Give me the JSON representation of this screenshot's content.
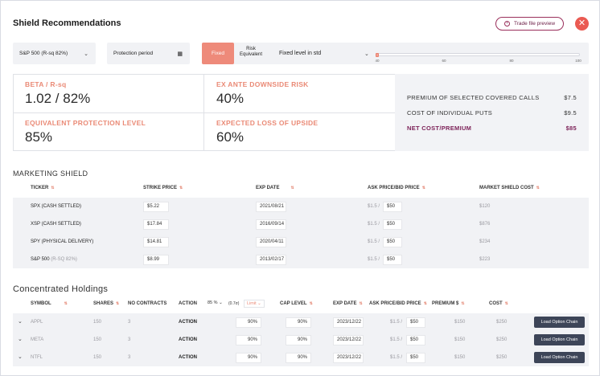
{
  "header": {
    "title": "Shield Recommendations",
    "trade_preview_label": "Trade file preview",
    "close_symbol": "✕"
  },
  "controls": {
    "index_select": "S&P 500 (R-sq 82%)",
    "protection_period_label": "Protection period",
    "fixed_label": "Fixed",
    "risk_equivalent_label": "Risk\nEquivalent",
    "risk_select": "Fixed level in std",
    "slider": {
      "ticks": [
        "40",
        "60",
        "80",
        "100"
      ],
      "value_fraction": 0.0
    }
  },
  "stats": {
    "beta_label": "BETA / R-sq",
    "beta_value": "1.02 / 82%",
    "risk_label": "EX ANTE DOWNSIDE RISK",
    "risk_value": "40%",
    "protect_label": "EQUIVALENT PROTECTION LEVEL",
    "protect_value": "85%",
    "loss_label": "EXPECTED LOSS OF UPSIDE",
    "loss_value": "60%"
  },
  "costs": [
    {
      "label": "PREMIUM OF SELECTED COVERED CALLS",
      "value": "$7.5"
    },
    {
      "label": "COST OF INDIVIDUAL PUTS",
      "value": "$9.5"
    },
    {
      "label": "NET COST/PREMIUM",
      "value": "$85"
    }
  ],
  "marketing": {
    "title": "MARKETING SHIELD",
    "headers": [
      "TICKER",
      "STRIKE PRICE",
      "EXP DATE",
      "ASK PRICE/BID PRICE",
      "MARKET SHIELD COST"
    ],
    "rows": [
      {
        "ticker": "SPX (CASH SETTLED)",
        "strike": "$5.22",
        "exp": "2021/08/21",
        "ask": "$1.5 /",
        "bid": "$50",
        "cost": "$120"
      },
      {
        "ticker": "XSP (CASH SETTLED)",
        "strike": "$17.84",
        "exp": "2016/09/14",
        "ask": "$1.5 /",
        "bid": "$50",
        "cost": "$876"
      },
      {
        "ticker": "SPY (PHYSICAL DELIVERY)",
        "strike": "$14.81",
        "exp": "2020/04/11",
        "ask": "$1.5 /",
        "bid": "$50",
        "cost": "$234"
      },
      {
        "ticker": "S&P 500",
        "ticker_suffix": "(R-SQ 82%)",
        "strike": "$8.99",
        "exp": "2013/02/17",
        "ask": "$1.5 /",
        "bid": "$50",
        "cost": "$223"
      }
    ]
  },
  "holdings": {
    "title": "Concentrated Holdings",
    "headers": {
      "symbol": "SYMBOL",
      "shares": "SHARES",
      "contracts": "NO CONTRACTS",
      "action": "ACTION",
      "action_pct": "85 %",
      "action_val": "(0.7σ)",
      "action_limit": "Limit",
      "cap": "CAP LEVEL",
      "exp": "EXP DATE",
      "ask": "ASK PRICE/BID PRICE",
      "premium": "PREMIUM $",
      "cost": "COST"
    },
    "rows": [
      {
        "symbol": "APPL",
        "shares": "150",
        "contracts": "3",
        "action": "ACTION",
        "pct": "90%",
        "cap": "90%",
        "exp": "2023/12/22",
        "ask": "$1.5 /",
        "bid": "$50",
        "premium": "$150",
        "cost": "$250",
        "btn": "Load Option Chain"
      },
      {
        "symbol": "META",
        "shares": "150",
        "contracts": "3",
        "action": "ACTION",
        "pct": "90%",
        "cap": "90%",
        "exp": "2023/12/22",
        "ask": "$1.5 /",
        "bid": "$50",
        "premium": "$150",
        "cost": "$250",
        "btn": "Load Option Chain"
      },
      {
        "symbol": "NTFL",
        "shares": "150",
        "contracts": "3",
        "action": "ACTION",
        "pct": "90%",
        "cap": "90%",
        "exp": "2023/12/22",
        "ask": "$1.5 /",
        "bid": "$50",
        "premium": "$150",
        "cost": "$250",
        "btn": "Load Option Chain"
      }
    ]
  },
  "colors": {
    "accent": "#ea8a76",
    "danger": "#ea5a52",
    "brand": "#7b1f56",
    "button_dark": "#3d4558"
  }
}
